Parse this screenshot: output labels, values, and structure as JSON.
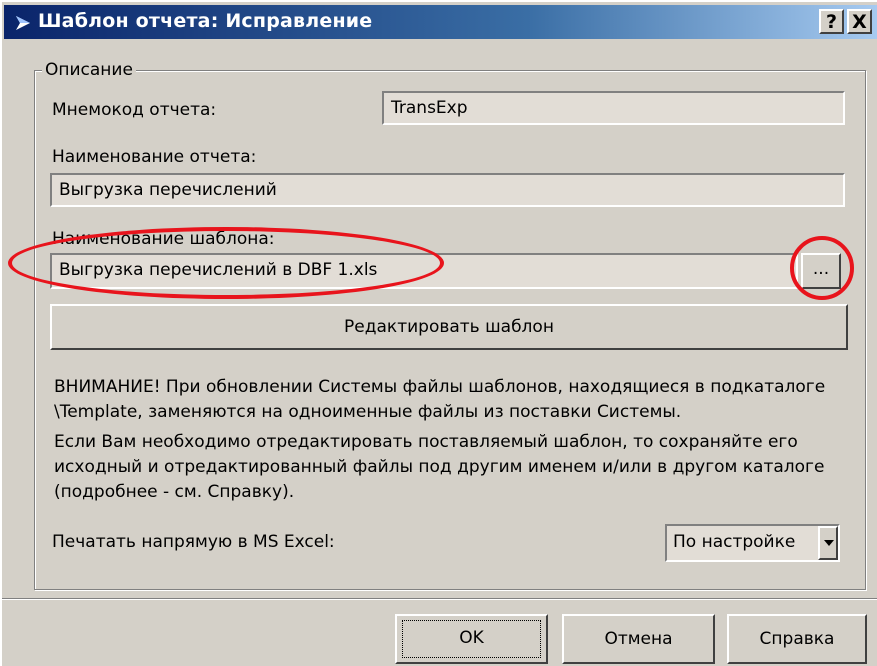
{
  "window": {
    "title": "Шаблон отчета: Исправление",
    "help_btn": "?",
    "close_btn": "X"
  },
  "group": {
    "legend": "Описание"
  },
  "fields": {
    "mnemocode_label": "Мнемокод отчета:",
    "mnemocode_value": "TransExp",
    "report_name_label": "Наименование отчета:",
    "report_name_value": "Выгрузка перечислений",
    "template_name_label": "Наименование шаблона:",
    "template_name_value": "Выгрузка перечислений в DBF 1.xls",
    "browse_label": "..."
  },
  "buttons": {
    "edit_template": "Редактировать шаблон",
    "ok": "OK",
    "cancel": "Отмена",
    "help": "Справка"
  },
  "notice": {
    "line1": "ВНИМАНИЕ! При обновлении Системы файлы шаблонов, находящиеся в подкаталоге",
    "line2": "\\Template, заменяются на одноименные файлы из поставки Системы.",
    "line3": "Если Вам необходимо отредактировать поставляемый шаблон, то сохраняйте его",
    "line4": "исходный и отредактированный файлы под другим именем и/или в другом каталоге",
    "line5": "(подробнее - см. Справку)."
  },
  "print_option": {
    "label": "Печатать напрямую в MS Excel:",
    "selected": "По настройке"
  },
  "colors": {
    "titlebar_start": "#0a246a",
    "titlebar_end": "#a6caf0",
    "dialog_bg": "#d4d0c8",
    "annotation": "#e8141c"
  }
}
